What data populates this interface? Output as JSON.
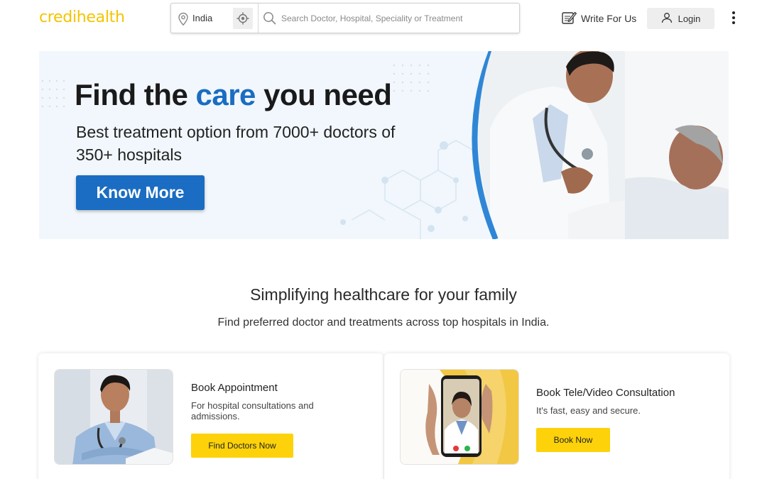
{
  "header": {
    "logo": "credihealth",
    "location_value": "India",
    "search_placeholder": "Search Doctor, Hospital, Speciality or Treatment",
    "write_for_us": "Write For Us",
    "login": "Login"
  },
  "hero": {
    "title_part1": "Find the ",
    "title_accent": "care",
    "title_part2": " you need",
    "subtitle": "Best treatment option from 7000+ doctors of 350+ hospitals",
    "button": "Know More",
    "accent_color": "#1a6dc2"
  },
  "section": {
    "title": "Simplifying healthcare for your family",
    "subtitle": "Find preferred doctor and treatments across top hospitals in India."
  },
  "cards": [
    {
      "title": "Book Appointment",
      "description": "For hospital consultations and admissions.",
      "button": "Find Doctors Now"
    },
    {
      "title": "Book Tele/Video Consultation",
      "description": "It's fast, easy and secure.",
      "button": "Book Now"
    }
  ],
  "colors": {
    "brand_yellow": "#f5c400",
    "button_yellow": "#fdd20a",
    "primary_blue": "#1a6dc2"
  },
  "icons": [
    "location-pin-icon",
    "gps-target-icon",
    "search-icon",
    "pen-notepad-icon",
    "user-icon",
    "kebab-menu-icon"
  ]
}
